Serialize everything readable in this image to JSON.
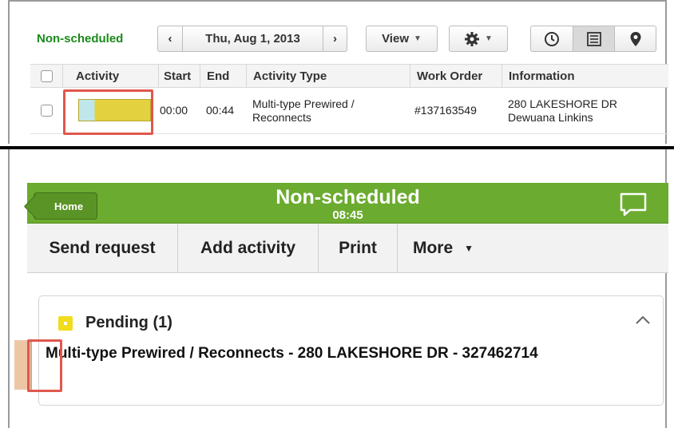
{
  "top": {
    "schedule_label": "Non-scheduled",
    "date": "Thu, Aug 1, 2013",
    "view_label": "View",
    "prev_arrow": "‹",
    "next_arrow": "›",
    "icons": [
      "settings-icon",
      "clock-icon",
      "list-icon",
      "location-pin-icon"
    ],
    "columns": [
      "Activity",
      "Start",
      "End",
      "Activity Type",
      "Work Order",
      "Information"
    ],
    "rows": [
      {
        "start": "00:00",
        "end": "00:44",
        "type_line1": "Multi-type Prewired /",
        "type_line2": "Reconnects",
        "work_order": "#137163549",
        "info_line1": "280 LAKESHORE DR",
        "info_line2": "Dewuana Linkins",
        "activity_colors": [
          "#bfe6ea",
          "#e3d13f"
        ]
      }
    ]
  },
  "mobile": {
    "home_label": "Home",
    "title": "Non-scheduled",
    "time": "08:45",
    "toolbar": [
      "Send request",
      "Add activity",
      "Print",
      "More"
    ],
    "pending_title": "Pending (1)",
    "pending_item": "Multi-type Prewired / Reconnects - 280 LAKESHORE DR - 327462714",
    "colors": {
      "header": "#6bab2f",
      "pending_badge": "#f2dc1c",
      "item_bar": "#edc7a5"
    }
  },
  "highlight_color": "#e0574d"
}
